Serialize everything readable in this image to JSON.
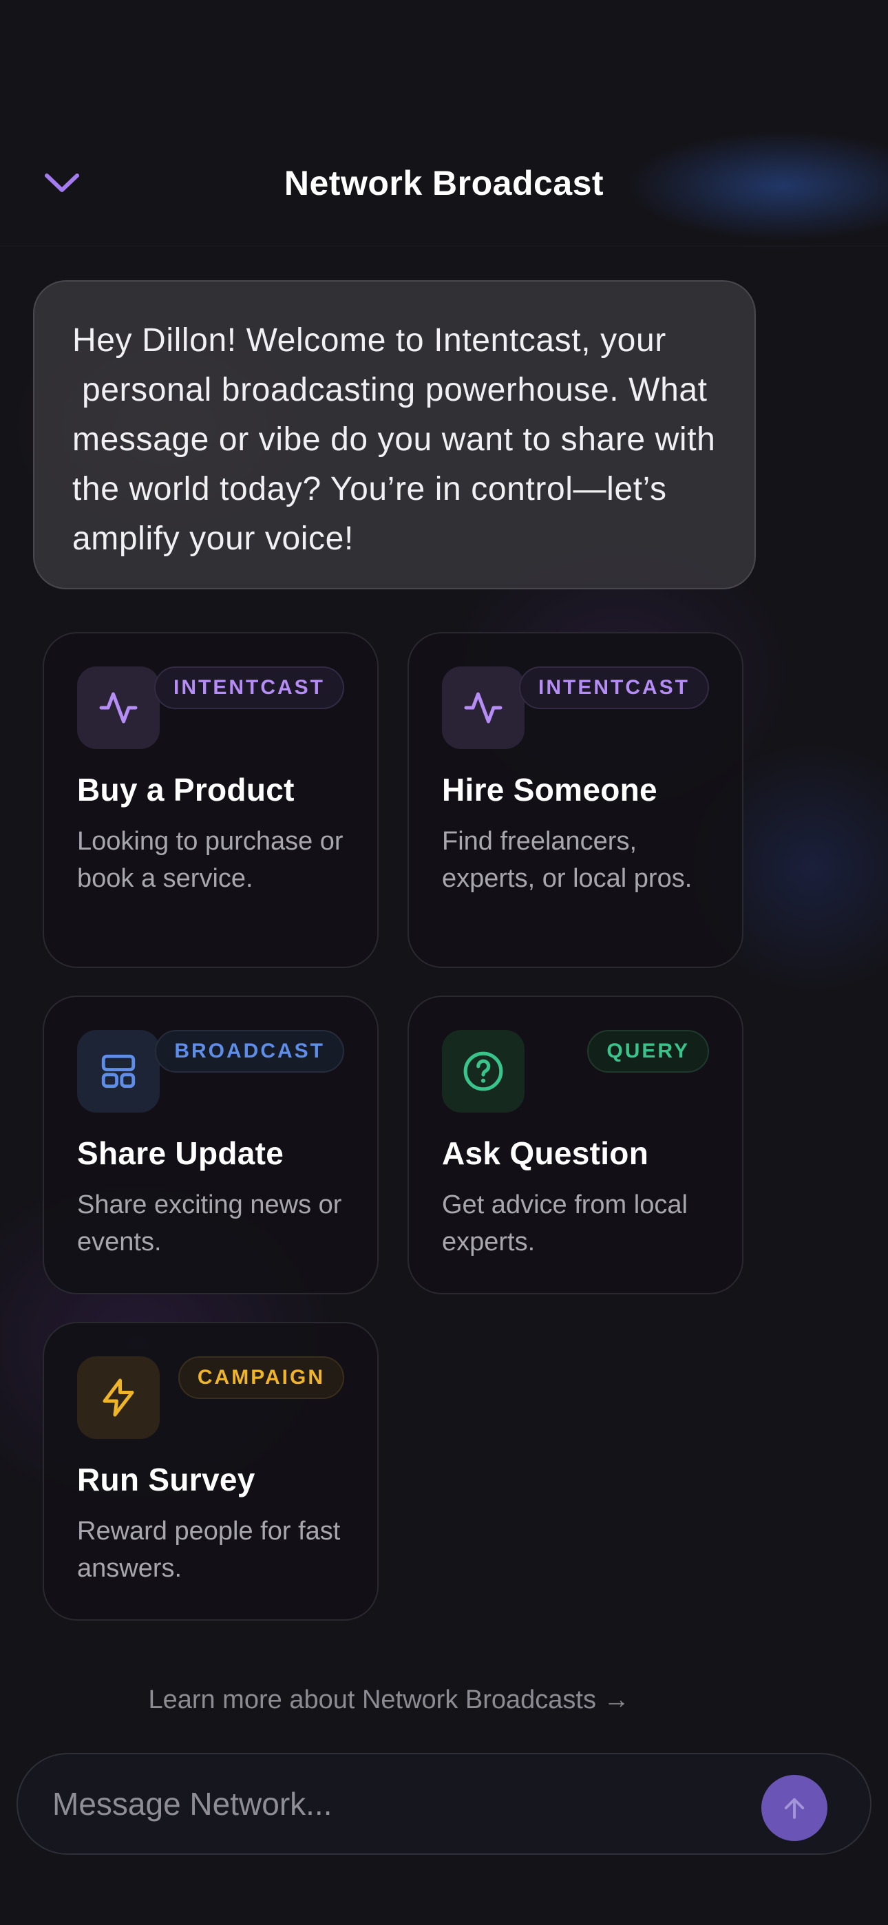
{
  "header": {
    "title": "Network Broadcast",
    "back_icon": "chevron-down-icon",
    "accent_color": "#a57cf0"
  },
  "welcome_message": "Hey Dillon! Welcome to Intentcast, your\n personal broadcasting powerhouse. What message or vibe do you want to share with the world today? You’re in control—let’s amplify your voice!",
  "cards": [
    {
      "title": "Buy a Product",
      "description": "Looking to purchase or book a service.",
      "badge": "INTENTCAST",
      "icon": "activity-pulse-icon",
      "color": "#b68cf5"
    },
    {
      "title": "Hire Someone",
      "description": "Find freelancers, experts, or local pros.",
      "badge": "INTENTCAST",
      "icon": "activity-pulse-icon",
      "color": "#b68cf5"
    },
    {
      "title": "Share Update",
      "description": "Share exciting news or events.",
      "badge": "BROADCAST",
      "icon": "layout-dashboard-icon",
      "color": "#5f8ee8"
    },
    {
      "title": "Ask Question",
      "description": "Get advice from local experts.",
      "badge": "QUERY",
      "icon": "help-circle-icon",
      "color": "#38c48a"
    },
    {
      "title": "Run Survey",
      "description": "Reward people for fast answers.",
      "badge": "CAMPAIGN",
      "icon": "lightning-bolt-icon",
      "color": "#f0b429"
    }
  ],
  "learn_more": "Learn more about Network Broadcasts →",
  "composer": {
    "placeholder": "Message Network...",
    "value": "",
    "send_icon": "arrow-up-icon",
    "send_color": "#6a55b6"
  }
}
